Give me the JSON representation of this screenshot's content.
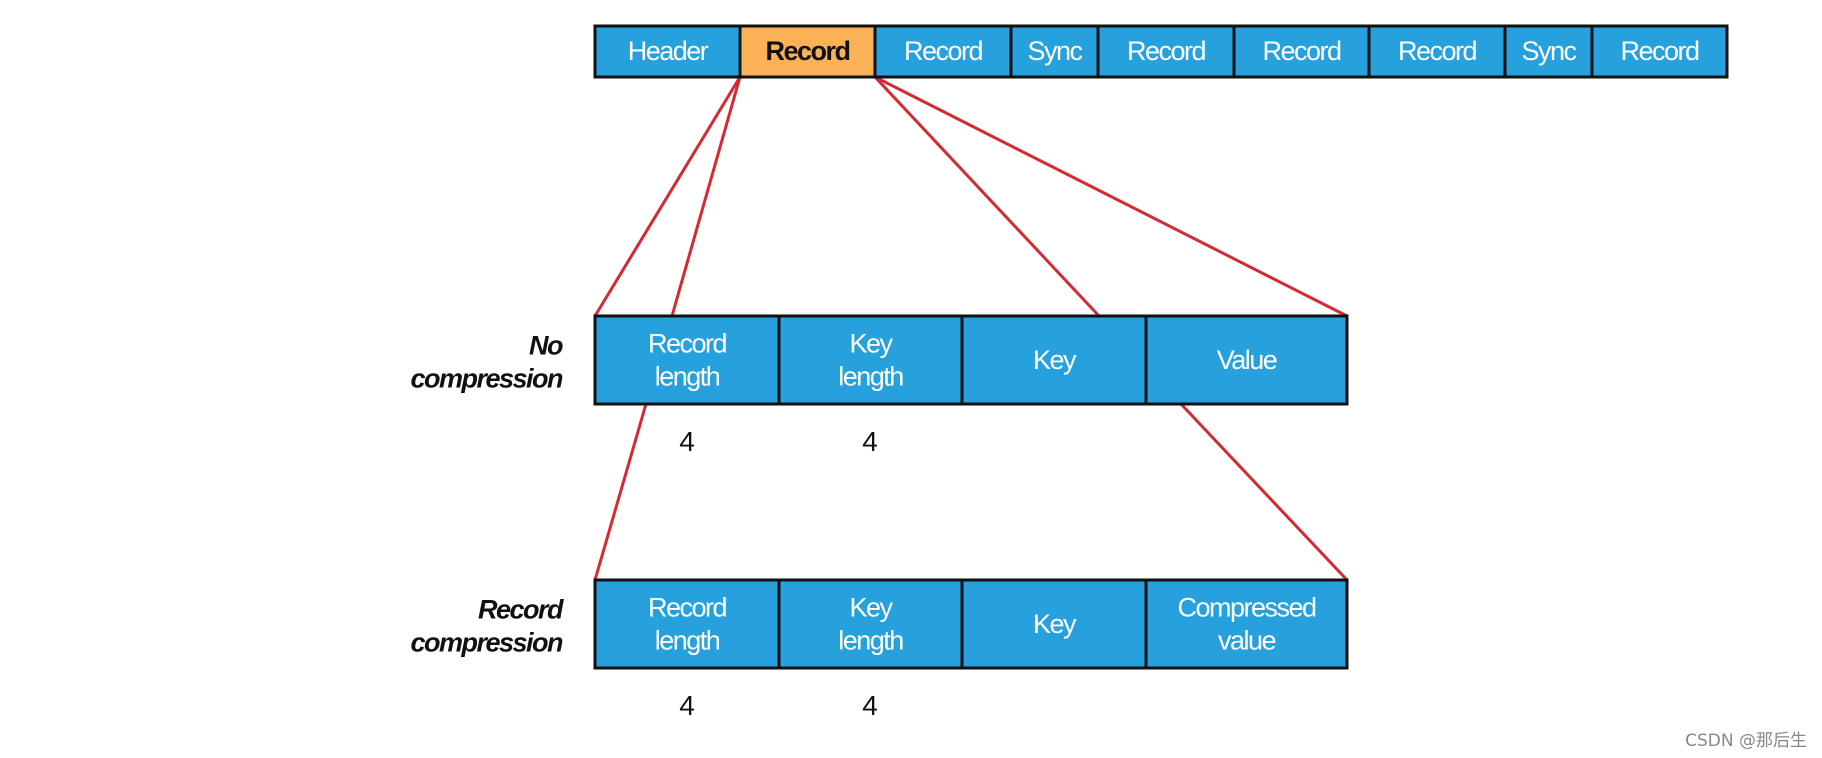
{
  "top_row": [
    "Header",
    "Record",
    "Record",
    "Sync",
    "Record",
    "Record",
    "Record",
    "Sync",
    "Record"
  ],
  "highlighted_index": 1,
  "rows": [
    {
      "label": [
        "No",
        "compression"
      ],
      "cells": [
        [
          "Record",
          "length"
        ],
        [
          "Key",
          "length"
        ],
        [
          "Key"
        ],
        [
          "Value"
        ]
      ],
      "sizes": [
        "4",
        "4"
      ]
    },
    {
      "label": [
        "Record",
        "compression"
      ],
      "cells": [
        [
          "Record",
          "length"
        ],
        [
          "Key",
          "length"
        ],
        [
          "Key"
        ],
        [
          "Compressed",
          "value"
        ]
      ],
      "sizes": [
        "4",
        "4"
      ]
    }
  ],
  "colors": {
    "cell": "#27a1dd",
    "highlight": "#fbb256",
    "connector": "#d42a33"
  },
  "watermark": "CSDN @那后生"
}
